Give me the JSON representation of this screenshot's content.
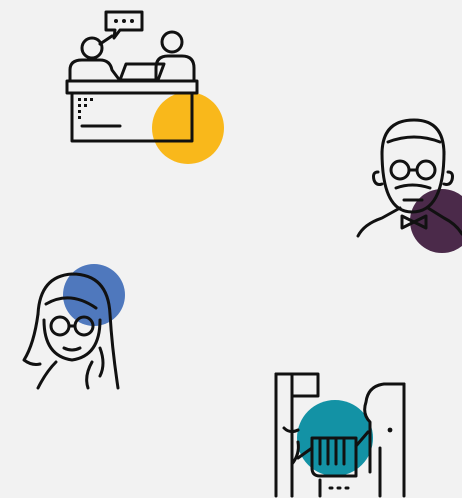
{
  "illustrations": [
    {
      "name": "meeting-desk-illustration",
      "accent": "#f9b81b",
      "icons": [
        "speech-bubble-icon",
        "laptop-icon",
        "desk-icon",
        "person-icon"
      ]
    },
    {
      "name": "elderly-man-illustration",
      "accent": "#4b2a4a",
      "icons": [
        "glasses-icon",
        "bow-tie-icon"
      ]
    },
    {
      "name": "woman-with-glasses-illustration",
      "accent": "#4f78bd",
      "icons": [
        "glasses-icon"
      ]
    },
    {
      "name": "handshake-illustration",
      "accent": "#1392a5",
      "icons": [
        "handshake-icon"
      ]
    }
  ]
}
